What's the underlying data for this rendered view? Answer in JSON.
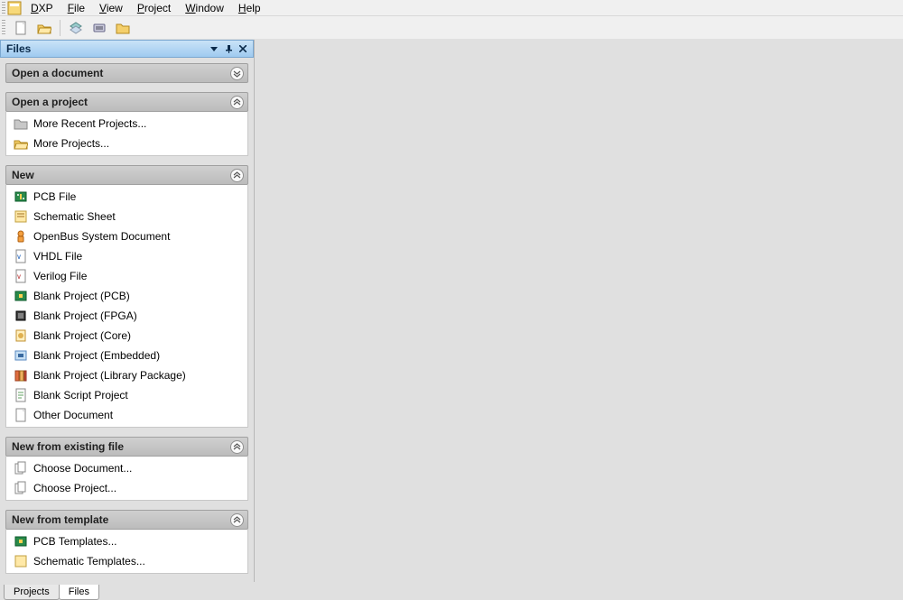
{
  "menu": {
    "app": "DXP",
    "items": [
      "File",
      "View",
      "Project",
      "Window",
      "Help"
    ]
  },
  "toolbar": {
    "new_doc": "New Document",
    "open": "Open",
    "layers": "Layers",
    "device": "Device View",
    "folder": "Open Project Folder"
  },
  "panel": {
    "title": "Files",
    "menu_btn": "▼",
    "pin_btn": "📌",
    "close_btn": "×"
  },
  "sections": {
    "open_document": {
      "title": "Open a document",
      "collapsed": true
    },
    "open_project": {
      "title": "Open a project",
      "items": [
        {
          "icon": "folder-gray",
          "label": "More Recent Projects..."
        },
        {
          "icon": "folder-open",
          "label": "More Projects..."
        }
      ]
    },
    "new": {
      "title": "New",
      "items": [
        {
          "icon": "pcb",
          "label": "PCB File"
        },
        {
          "icon": "schematic",
          "label": "Schematic Sheet"
        },
        {
          "icon": "openbus",
          "label": "OpenBus System Document"
        },
        {
          "icon": "vhdl",
          "label": "VHDL File"
        },
        {
          "icon": "verilog",
          "label": "Verilog File"
        },
        {
          "icon": "pcb",
          "label": "Blank Project (PCB)"
        },
        {
          "icon": "fpga",
          "label": "Blank Project (FPGA)"
        },
        {
          "icon": "core",
          "label": "Blank Project (Core)"
        },
        {
          "icon": "embedded",
          "label": "Blank Project (Embedded)"
        },
        {
          "icon": "library",
          "label": "Blank Project (Library Package)"
        },
        {
          "icon": "script",
          "label": "Blank Script Project"
        },
        {
          "icon": "doc",
          "label": "Other Document"
        }
      ]
    },
    "new_from_existing": {
      "title": "New from existing file",
      "items": [
        {
          "icon": "copy-doc",
          "label": "Choose Document..."
        },
        {
          "icon": "copy-doc",
          "label": "Choose Project..."
        }
      ]
    },
    "new_from_template": {
      "title": "New from template",
      "items": [
        {
          "icon": "pcb",
          "label": "PCB Templates..."
        },
        {
          "icon": "schematic",
          "label": "Schematic Templates..."
        }
      ]
    }
  },
  "bottom_tabs": {
    "projects": "Projects",
    "files": "Files"
  }
}
